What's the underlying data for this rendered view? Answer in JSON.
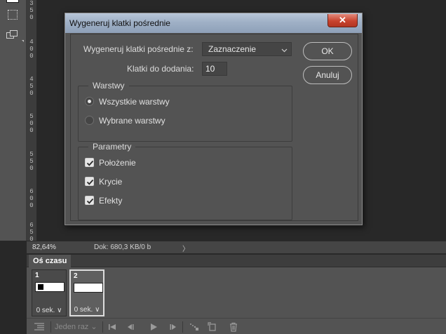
{
  "dialog": {
    "title": "Wygeneruj klatki pośrednie",
    "close_label": "✕",
    "tween_with_label": "Wygeneruj klatki pośrednie z:",
    "tween_with_value": "Zaznaczenie",
    "frames_to_add_label": "Klatki do dodania:",
    "frames_to_add_value": "10",
    "ok_label": "OK",
    "cancel_label": "Anuluj",
    "layers_group": {
      "title": "Warstwy",
      "options": [
        {
          "label": "Wszystkie warstwy",
          "selected": true
        },
        {
          "label": "Wybrane warstwy",
          "selected": false
        }
      ]
    },
    "params_group": {
      "title": "Parametry",
      "options": [
        {
          "label": "Położenie",
          "checked": true
        },
        {
          "label": "Krycie",
          "checked": true
        },
        {
          "label": "Efekty",
          "checked": true
        }
      ]
    }
  },
  "ruler": {
    "labels": [
      "3\n5\n0",
      "4\n0\n0",
      "4\n5\n0",
      "5\n0\n0",
      "5\n5\n0",
      "6\n0\n0",
      "6\n5\n0"
    ]
  },
  "statusbar": {
    "zoom": "82,64%",
    "doc_info": "Dok: 680,3 KB/0 b",
    "arrow": "〉"
  },
  "timeline": {
    "tab_label": "Oś czasu",
    "frames": [
      {
        "number": "1",
        "delay": "0 sek.",
        "selected": false
      },
      {
        "number": "2",
        "delay": "0 sek.",
        "selected": true
      }
    ],
    "loop_label": "Jeden raz"
  },
  "icons": {
    "chevron": "chevron-down-icon",
    "checkmark": "checkmark-icon"
  }
}
